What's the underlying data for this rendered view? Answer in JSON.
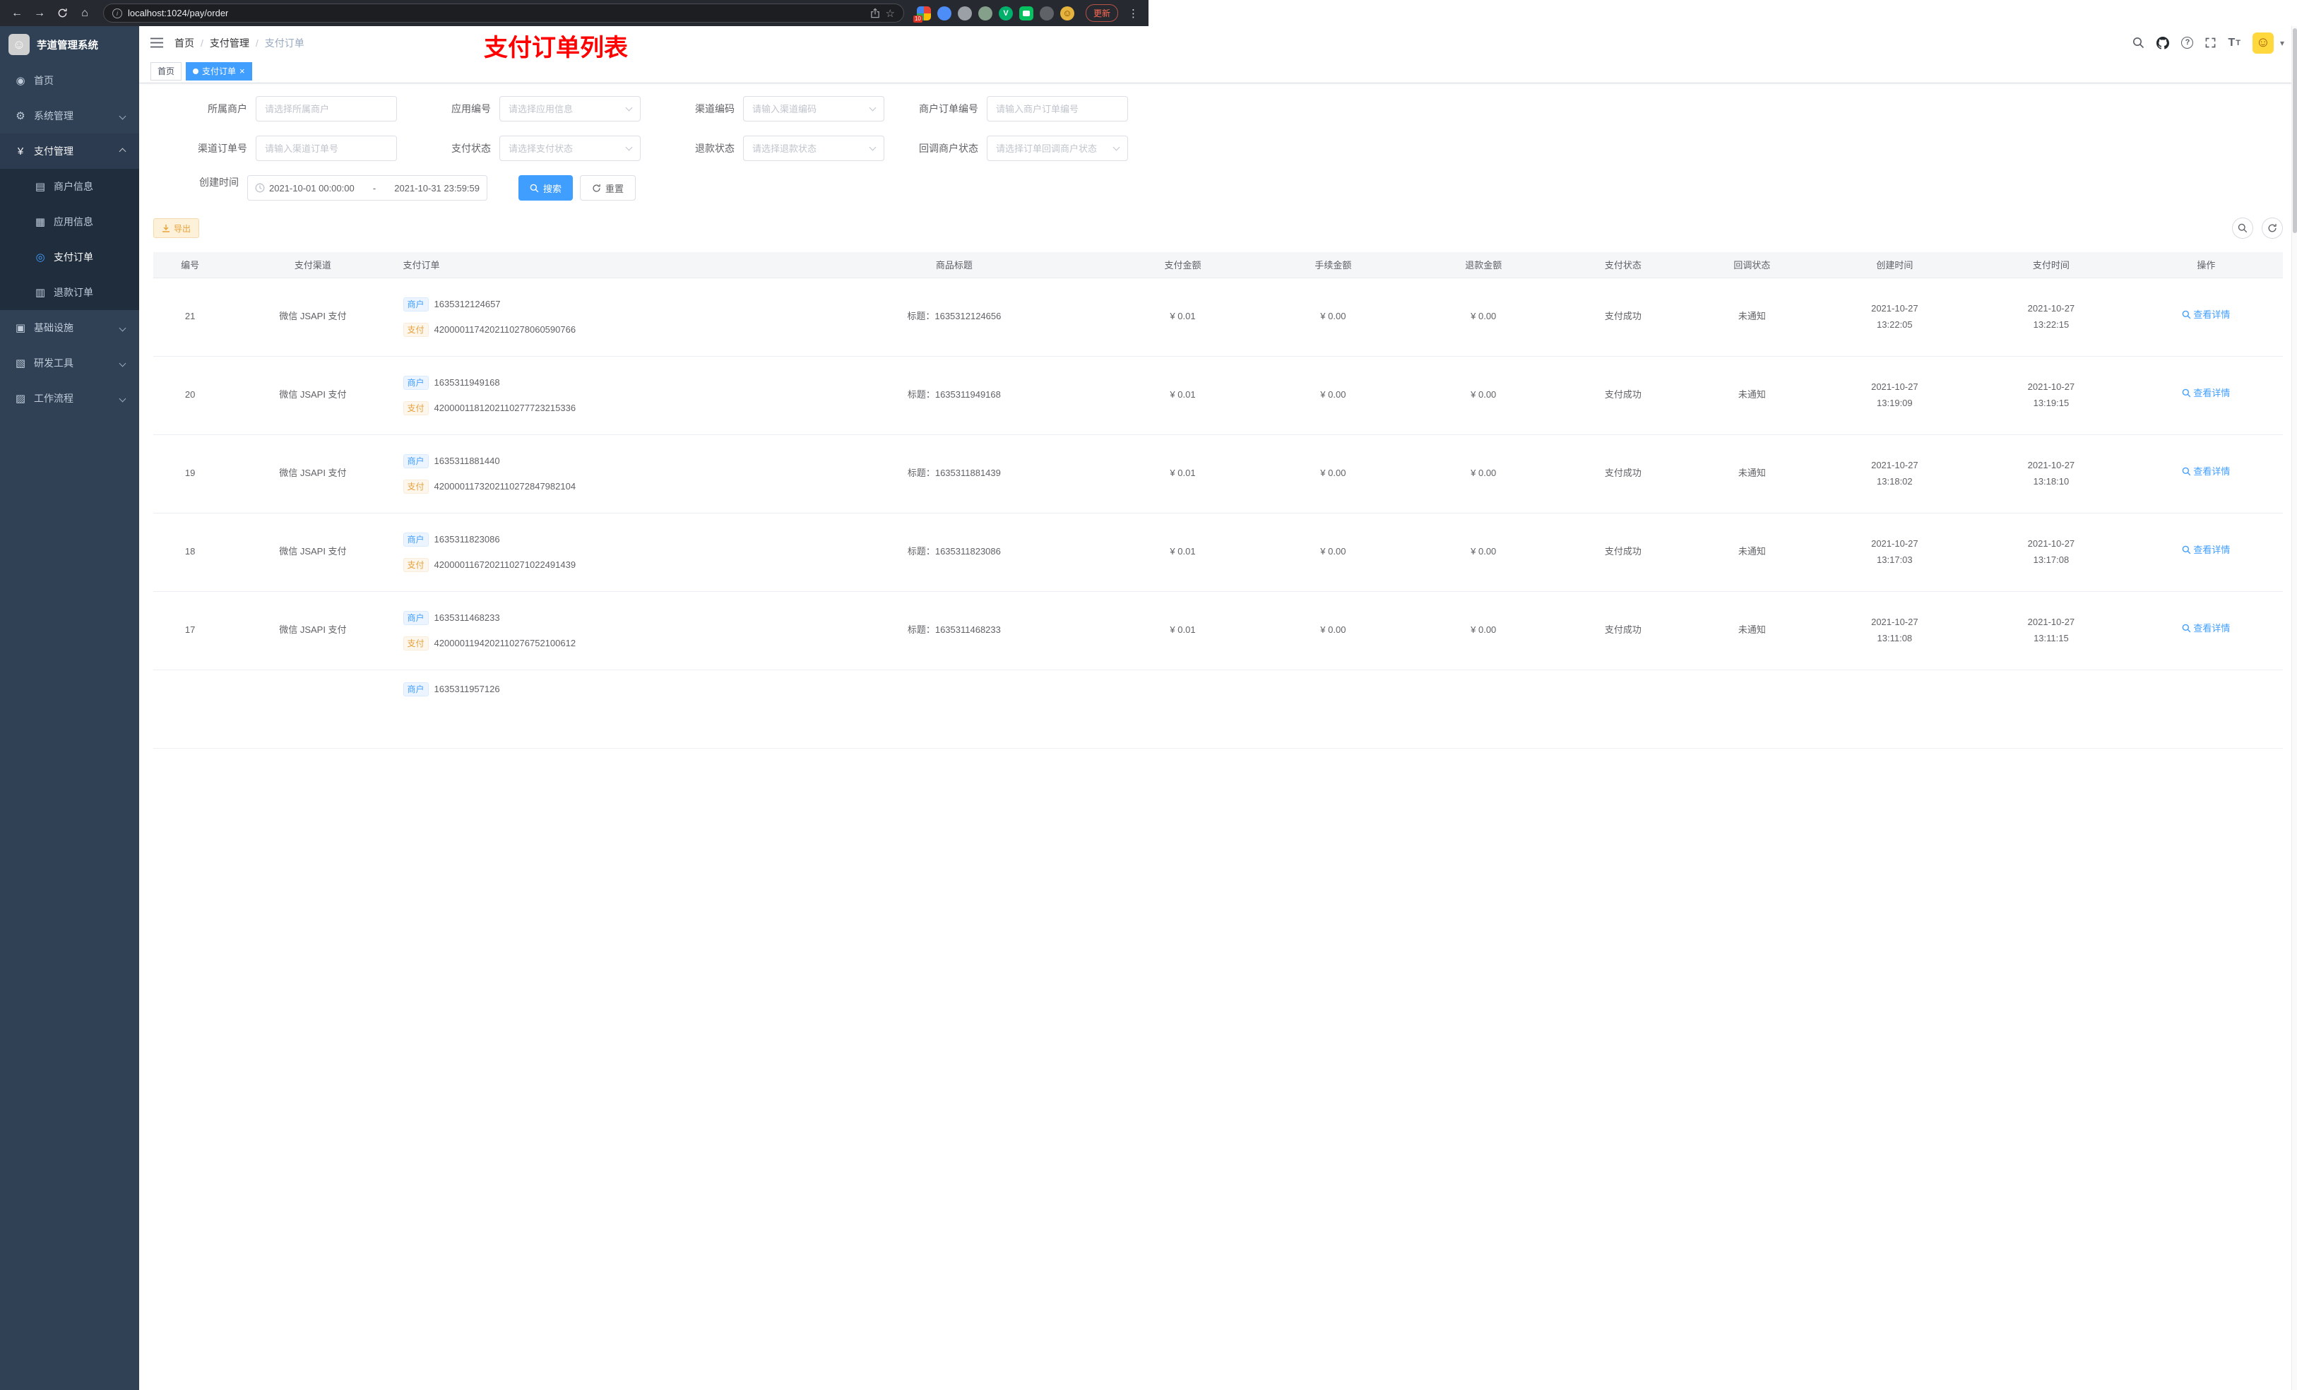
{
  "browser": {
    "url": "localhost:1024/pay/order",
    "update_label": "更新",
    "extension_badge": "10"
  },
  "icons": {
    "back": "←",
    "forward": "→",
    "home": "⌂",
    "star": "☆",
    "kebab": "⋮",
    "caret": "▾",
    "close": "×",
    "help": "?",
    "smiley": "☺",
    "font_big": "T",
    "font_small": "T"
  },
  "sidebar": {
    "title": "芋道管理系统",
    "items": [
      {
        "label": "首页",
        "icon": "dashboard-icon",
        "glyph": "◉"
      },
      {
        "label": "系统管理",
        "icon": "gear-icon",
        "glyph": "⚙"
      },
      {
        "label": "支付管理",
        "icon": "payment-icon",
        "glyph": "¥",
        "expanded": true,
        "children": [
          {
            "label": "商户信息",
            "icon": "merchant-icon",
            "glyph": "▤"
          },
          {
            "label": "应用信息",
            "icon": "app-icon",
            "glyph": "▦"
          },
          {
            "label": "支付订单",
            "icon": "pay-order-icon",
            "glyph": "◎",
            "active": true
          },
          {
            "label": "退款订单",
            "icon": "refund-order-icon",
            "glyph": "▥"
          }
        ]
      },
      {
        "label": "基础设施",
        "icon": "infrastructure-icon",
        "glyph": "▣"
      },
      {
        "label": "研发工具",
        "icon": "devtools-icon",
        "glyph": "▧"
      },
      {
        "label": "工作流程",
        "icon": "workflow-icon",
        "glyph": "▨"
      }
    ]
  },
  "header": {
    "breadcrumb": [
      "首页",
      "支付管理",
      "支付订单"
    ],
    "annotation": "支付订单列表"
  },
  "tabs": [
    {
      "label": "首页"
    },
    {
      "label": "支付订单"
    }
  ],
  "filters": {
    "merchant": {
      "label": "所属商户",
      "placeholder": "请选择所属商户"
    },
    "app_no": {
      "label": "应用编号",
      "placeholder": "请选择应用信息"
    },
    "channel_code": {
      "label": "渠道编码",
      "placeholder": "请输入渠道编码"
    },
    "merchant_order_no": {
      "label": "商户订单编号",
      "placeholder": "请输入商户订单编号"
    },
    "channel_order_no": {
      "label": "渠道订单号",
      "placeholder": "请输入渠道订单号"
    },
    "pay_status": {
      "label": "支付状态",
      "placeholder": "请选择支付状态"
    },
    "refund_status": {
      "label": "退款状态",
      "placeholder": "请选择退款状态"
    },
    "notify_status": {
      "label": "回调商户状态",
      "placeholder": "请选择订单回调商户状态"
    },
    "create_time": {
      "label": "创建时间",
      "start": "2021-10-01 00:00:00",
      "separator": "-",
      "end": "2021-10-31 23:59:59"
    },
    "search": "搜索",
    "reset": "重置"
  },
  "toolbar": {
    "export": "导出"
  },
  "table": {
    "columns": [
      "编号",
      "支付渠道",
      "支付订单",
      "商品标题",
      "支付金额",
      "手续金额",
      "退款金额",
      "支付状态",
      "回调状态",
      "创建时间",
      "支付时间",
      "操作"
    ],
    "tags": {
      "merchant": "商户",
      "pay": "支付"
    },
    "action": "查看详情",
    "rows": [
      {
        "id": "21",
        "channel": "微信 JSAPI 支付",
        "merchant_no": "1635312124657",
        "pay_no": "4200001174202110278060590766",
        "title": "标题：1635312124656",
        "amount": "¥ 0.01",
        "fee": "¥ 0.00",
        "refund": "¥ 0.00",
        "status": "支付成功",
        "notify": "未通知",
        "create_date": "2021-10-27",
        "create_time": "13:22:05",
        "pay_date": "2021-10-27",
        "pay_time": "13:22:15"
      },
      {
        "id": "20",
        "channel": "微信 JSAPI 支付",
        "merchant_no": "1635311949168",
        "pay_no": "4200001181202110277723215336",
        "title": "标题：1635311949168",
        "amount": "¥ 0.01",
        "fee": "¥ 0.00",
        "refund": "¥ 0.00",
        "status": "支付成功",
        "notify": "未通知",
        "create_date": "2021-10-27",
        "create_time": "13:19:09",
        "pay_date": "2021-10-27",
        "pay_time": "13:19:15"
      },
      {
        "id": "19",
        "channel": "微信 JSAPI 支付",
        "merchant_no": "1635311881440",
        "pay_no": "4200001173202110272847982104",
        "title": "标题：1635311881439",
        "amount": "¥ 0.01",
        "fee": "¥ 0.00",
        "refund": "¥ 0.00",
        "status": "支付成功",
        "notify": "未通知",
        "create_date": "2021-10-27",
        "create_time": "13:18:02",
        "pay_date": "2021-10-27",
        "pay_time": "13:18:10"
      },
      {
        "id": "18",
        "channel": "微信 JSAPI 支付",
        "merchant_no": "1635311823086",
        "pay_no": "4200001167202110271022491439",
        "title": "标题：1635311823086",
        "amount": "¥ 0.01",
        "fee": "¥ 0.00",
        "refund": "¥ 0.00",
        "status": "支付成功",
        "notify": "未通知",
        "create_date": "2021-10-27",
        "create_time": "13:17:03",
        "pay_date": "2021-10-27",
        "pay_time": "13:17:08"
      },
      {
        "id": "17",
        "channel": "微信 JSAPI 支付",
        "merchant_no": "1635311468233",
        "pay_no": "4200001194202110276752100612",
        "title": "标题：1635311468233",
        "amount": "¥ 0.01",
        "fee": "¥ 0.00",
        "refund": "¥ 0.00",
        "status": "支付成功",
        "notify": "未通知",
        "create_date": "2021-10-27",
        "create_time": "13:11:08",
        "pay_date": "2021-10-27",
        "pay_time": "13:11:15"
      }
    ],
    "partial_row": {
      "merchant_no": "1635311957126"
    }
  }
}
